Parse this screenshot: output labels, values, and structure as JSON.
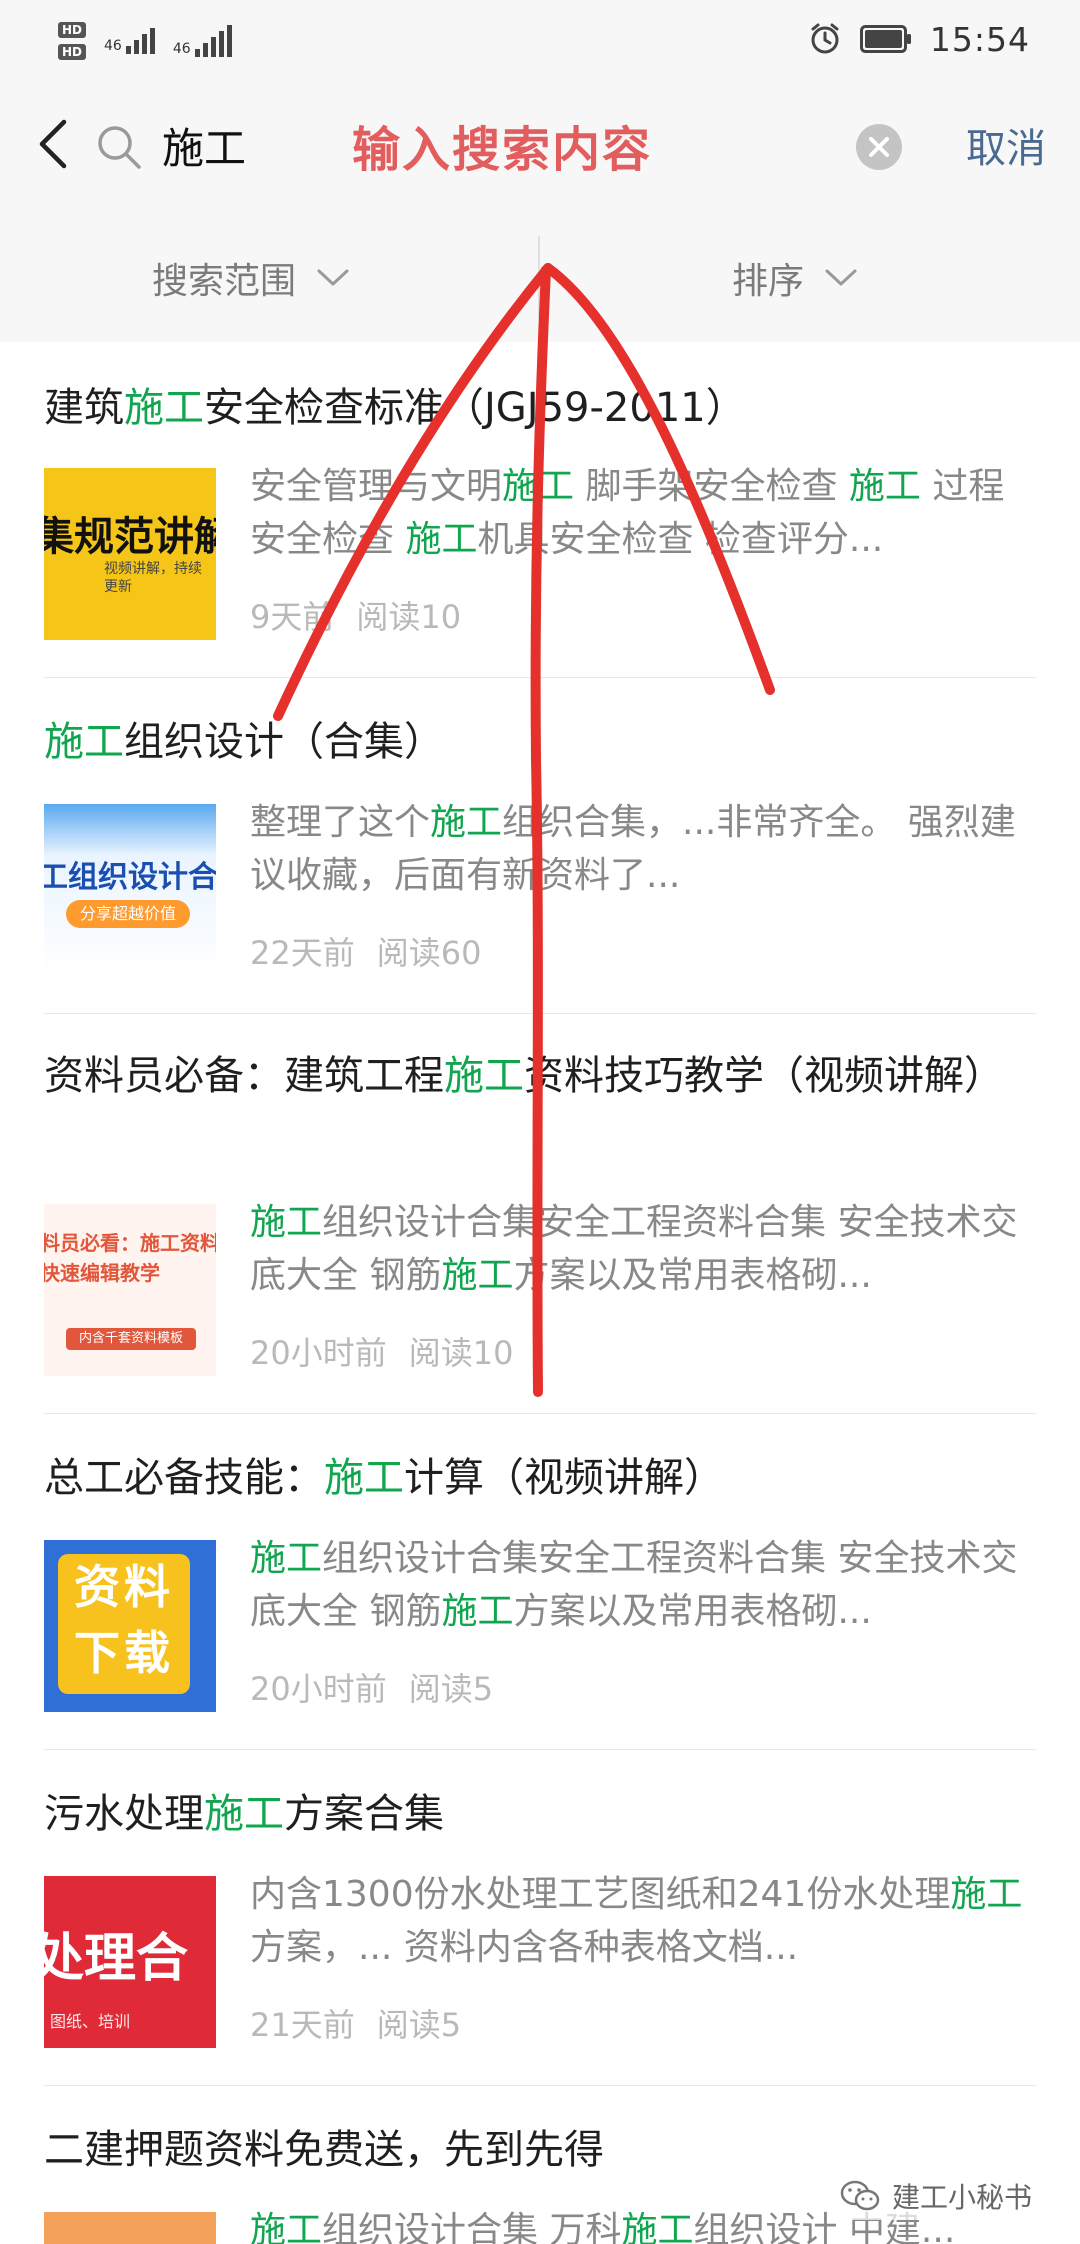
{
  "status_bar": {
    "hd1": "HD",
    "hd2": "HD",
    "network1": "46",
    "network2": "46",
    "time": "15:54"
  },
  "search": {
    "value": "施工",
    "annotation": "输入搜索内容",
    "cancel_label": "取消"
  },
  "filters": {
    "range_label": "搜索范围",
    "sort_label": "排序"
  },
  "results": [
    {
      "title_parts": [
        "建筑",
        "施工",
        "安全检查标准（JGJ59-2011）"
      ],
      "summary_parts": [
        "安全管理与文明",
        "施工",
        " 脚手架安全检查 ",
        "施工",
        " 过程安全检查 ",
        "施工",
        "机具安全检查 检查评分..."
      ],
      "time": "9天前",
      "reads": "阅读10",
      "thumb_text": "集规范讲解",
      "thumb_sub": "视频讲解，持续更新"
    },
    {
      "title_parts": [
        "",
        "施工",
        "组织设计（合集）"
      ],
      "summary_parts": [
        "整理了这个",
        "施工",
        "组织合集，...非常齐全。 强烈建议收藏，后面有新资料了..."
      ],
      "time": "22天前",
      "reads": "阅读60",
      "thumb_text": "工组织设计合",
      "thumb_sub": "分享超越价值"
    },
    {
      "title_parts": [
        "资料员必备：建筑工程",
        "施工",
        "资料技巧教学（视频讲解）"
      ],
      "summary_parts": [
        "",
        "施工",
        "组织设计合集安全工程资料合集 安全技术交底大全 钢筋",
        "施工",
        "方案以及常用表格砌..."
      ],
      "time": "20小时前",
      "reads": "阅读10",
      "thumb_text": "料员必看：施工资料快速编辑教学",
      "thumb_sub": "内含千套资料模板"
    },
    {
      "title_parts": [
        "总工必备技能：",
        "施工",
        "计算（视频讲解）"
      ],
      "summary_parts": [
        "",
        "施工",
        "组织设计合集安全工程资料合集 安全技术交底大全 钢筋",
        "施工",
        "方案以及常用表格砌..."
      ],
      "time": "20小时前",
      "reads": "阅读5",
      "thumb_text": "资料下载",
      "thumb_sub": ""
    },
    {
      "title_parts": [
        "污水处理",
        "施工",
        "方案合集"
      ],
      "summary_parts": [
        "内含1300份水处理工艺图纸和241份水处理",
        "施工",
        "方案，... 资料内含各种表格文档..."
      ],
      "time": "21天前",
      "reads": "阅读5",
      "thumb_text": "处理合",
      "thumb_sub": "图纸、培训"
    },
    {
      "title_parts": [
        "二建押题资料免费送，先到先得",
        "",
        ""
      ],
      "summary_parts": [
        "",
        "施工",
        "组织设计合集 万科",
        "施工",
        "组织设计 中建..."
      ],
      "time": "",
      "reads": "",
      "thumb_text": "",
      "thumb_sub": ""
    }
  ],
  "watermark": {
    "text": "建工小秘书"
  },
  "colors": {
    "highlight": "#12a550",
    "annotation": "#e25d5d",
    "cancel": "#4a6a92",
    "summary": "#888888",
    "meta": "#b9b9b9"
  }
}
